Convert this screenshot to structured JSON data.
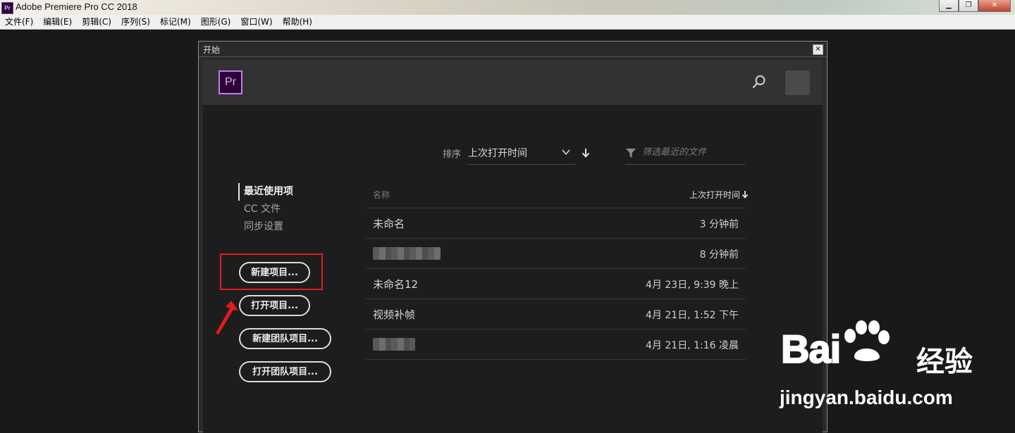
{
  "window": {
    "app_icon": "Pr",
    "title": "Adobe Premiere Pro CC 2018",
    "buttons": [
      "minimize",
      "restore",
      "close"
    ]
  },
  "menu": [
    "文件(F)",
    "编辑(E)",
    "剪辑(C)",
    "序列(S)",
    "标记(M)",
    "图形(G)",
    "窗口(W)",
    "帮助(H)"
  ],
  "dialog": {
    "title": "开始",
    "close_glyph": "×",
    "logo": "Pr",
    "sort": {
      "label": "排序",
      "value": "上次打开时间"
    },
    "filter": {
      "placeholder": "筛选最近的文件"
    },
    "nav": [
      "最近使用项",
      "CC 文件",
      "同步设置"
    ],
    "buttons": {
      "new_project": "新建项目...",
      "open_project": "打开项目...",
      "new_team_project": "新建团队项目...",
      "open_team_project": "打开团队项目..."
    },
    "table": {
      "col_name": "名称",
      "col_time": "上次打开时间",
      "rows": [
        {
          "name": "未命名",
          "time": "3 分钟前"
        },
        {
          "name": "",
          "time": "8 分钟前"
        },
        {
          "name": "未命名12",
          "time": "4月 23日, 9:39 晚上"
        },
        {
          "name": "视频补帧",
          "time": "4月 21日, 1:52 下午"
        },
        {
          "name": "",
          "time": "4月 21日, 1:16 凌晨"
        }
      ]
    }
  },
  "watermark": {
    "brand": "Bai",
    "brand_suffix": "经验",
    "url": "jingyan.baidu.com"
  },
  "colors": {
    "highlight": "#e11c1c",
    "logo_accent": "#c07cf0"
  }
}
